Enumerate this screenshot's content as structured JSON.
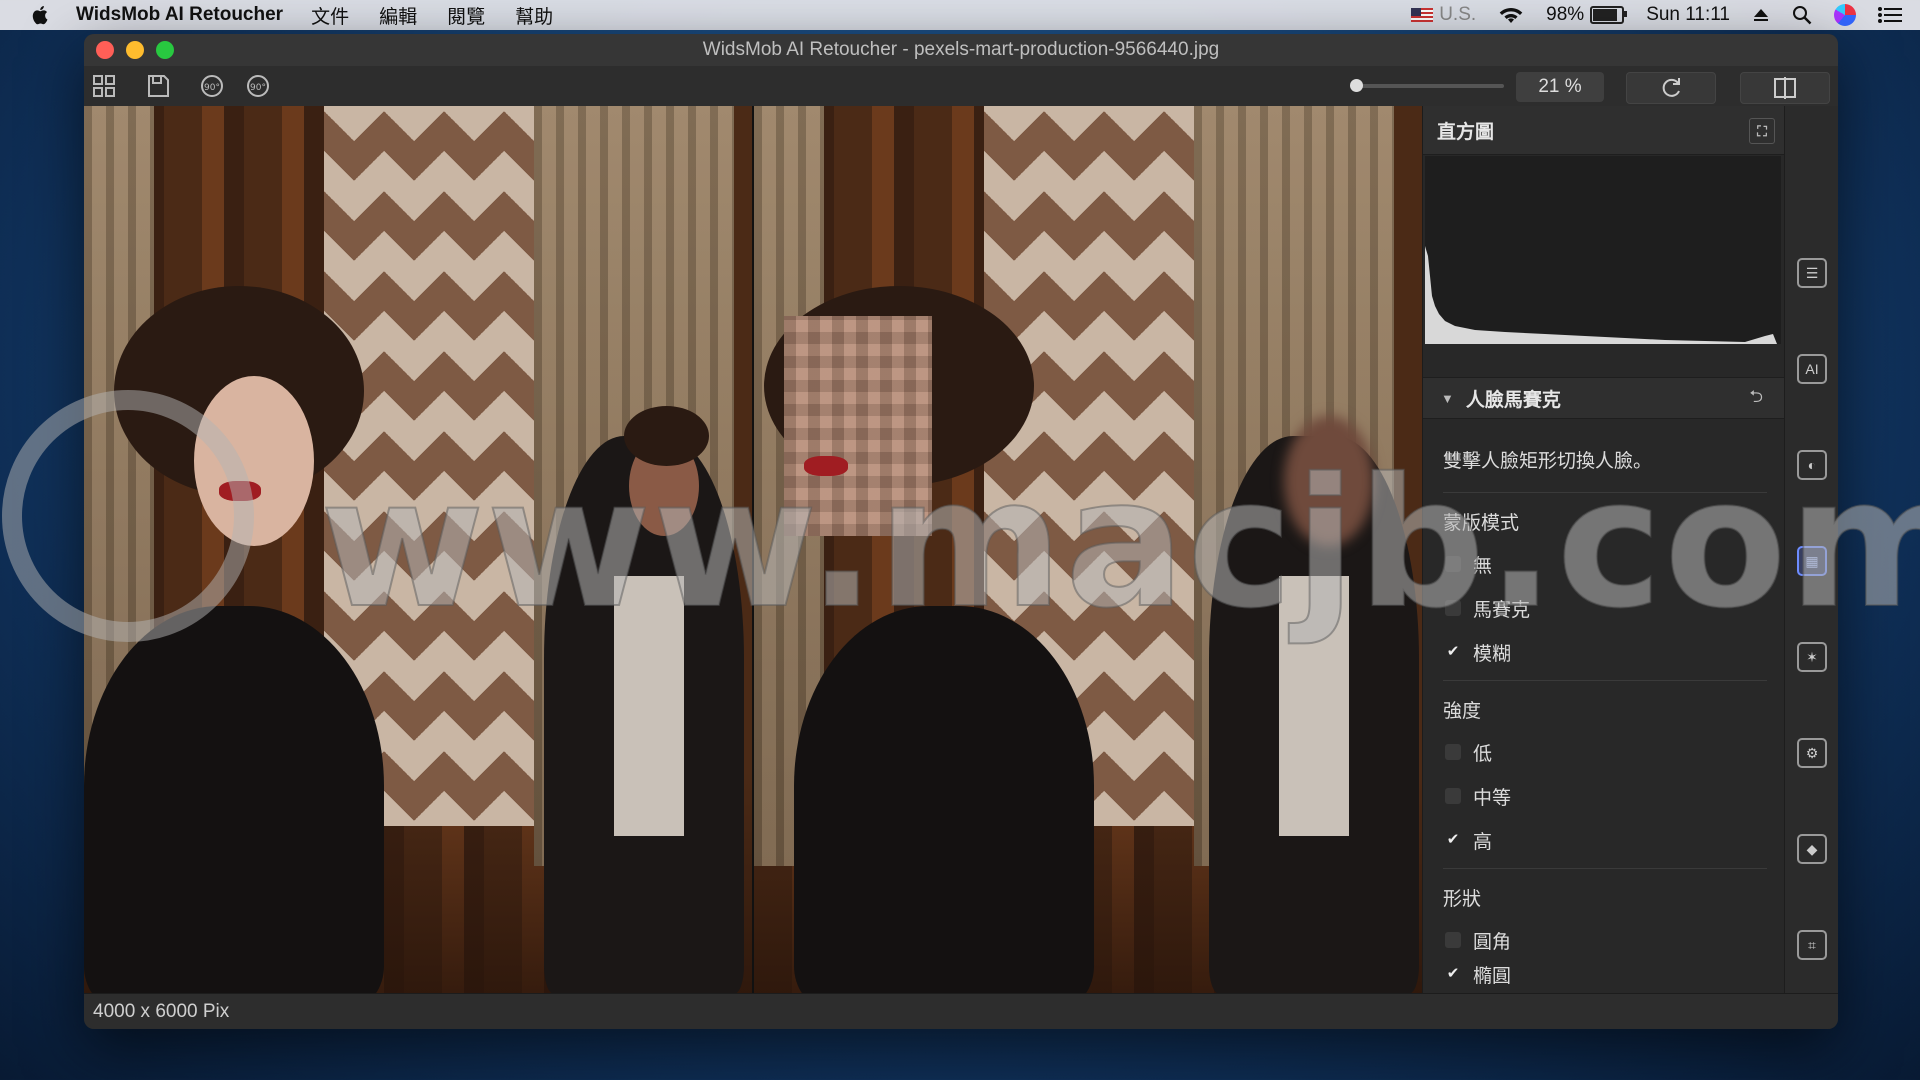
{
  "menubar": {
    "app_name": "WidsMob AI Retoucher",
    "menus": [
      "文件",
      "編輯",
      "閱覽",
      "幫助"
    ],
    "input_source": "U.S.",
    "battery": "98%",
    "clock": "Sun 11:11"
  },
  "window": {
    "title": "WidsMob AI Retoucher - pexels-mart-production-9566440.jpg"
  },
  "toolbar": {
    "zoom": "21 %",
    "zoom_level": 0.0
  },
  "panel": {
    "histogram_title": "直方圖",
    "section_title": "人臉馬賽克",
    "hint": "雙擊人臉矩形切換人臉。",
    "mask_mode": {
      "title": "蒙版模式",
      "options": [
        {
          "label": "無",
          "checked": false
        },
        {
          "label": "馬賽克",
          "checked": false
        },
        {
          "label": "模糊",
          "checked": true
        }
      ]
    },
    "strength": {
      "title": "強度",
      "options": [
        {
          "label": "低",
          "checked": false
        },
        {
          "label": "中等",
          "checked": false
        },
        {
          "label": "高",
          "checked": true
        }
      ]
    },
    "shape": {
      "title": "形狀",
      "options": [
        {
          "label": "圓角",
          "checked": false
        },
        {
          "label": "橢圓",
          "checked": true
        }
      ]
    }
  },
  "status": {
    "dimensions": "4000 x 6000 Pix"
  },
  "watermark": {
    "text": "www.macjb.com"
  },
  "colors": {
    "accent": "#6d8cff",
    "panel_bg": "#282828",
    "lipstick": "#a01d22"
  }
}
